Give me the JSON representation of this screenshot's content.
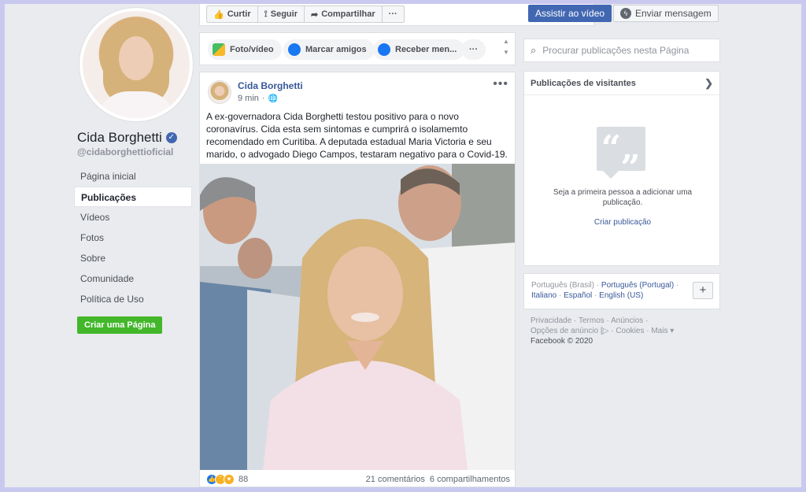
{
  "page": {
    "name": "Cida Borghetti",
    "handle": "@cidaborghettioficial"
  },
  "nav": {
    "items": [
      {
        "label": "Página inicial",
        "active": false
      },
      {
        "label": "Publicações",
        "active": true
      },
      {
        "label": "Vídeos",
        "active": false
      },
      {
        "label": "Fotos",
        "active": false
      },
      {
        "label": "Sobre",
        "active": false
      },
      {
        "label": "Comunidade",
        "active": false
      },
      {
        "label": "Política de Uso",
        "active": false
      }
    ],
    "create_page": "Criar uma Página"
  },
  "toolbar": {
    "like": "Curtir",
    "follow": "Seguir",
    "share": "Compartilhar",
    "more": "···",
    "watch_video": "Assistir ao vídeo",
    "send_message": "Enviar mensagem"
  },
  "composer": {
    "photo_video": "Foto/vídeo",
    "tag_friends": "Marcar amigos",
    "receive_msg": "Receber men...",
    "more": "···"
  },
  "post": {
    "author": "Cida Borghetti",
    "time": "9 min",
    "text": "A ex-governadora Cida Borghetti testou positivo para o novo coronavírus. Cida esta sem sintomas e cumprirá o isolamemto recomendado em Curitiba. A deputada estadual Maria Victoria e seu marido, o advogado Diego Campos, testaram negativo para o Covid-19.",
    "reaction_count": "88",
    "comments": "21 comentários",
    "shares": "6 compartilhamentos"
  },
  "search": {
    "placeholder": "Procurar publicações nesta Página"
  },
  "visitors": {
    "title": "Publicações de visitantes",
    "message": "Seja a primeira pessoa a adicionar uma publicação.",
    "link": "Criar publicação"
  },
  "languages": {
    "current": "Português (Brasil)",
    "others": [
      "Português (Portugal)",
      "Italiano",
      "Español",
      "English (US)"
    ]
  },
  "legal": {
    "links": [
      "Privacidade",
      "Termos",
      "Anúncios",
      "Opções de anúncio",
      "Cookies",
      "Mais"
    ],
    "copyright": "Facebook © 2020"
  },
  "colors": {
    "brand": "#4267b2",
    "link": "#385898",
    "green": "#42b72a",
    "bg": "#e9ebee"
  }
}
